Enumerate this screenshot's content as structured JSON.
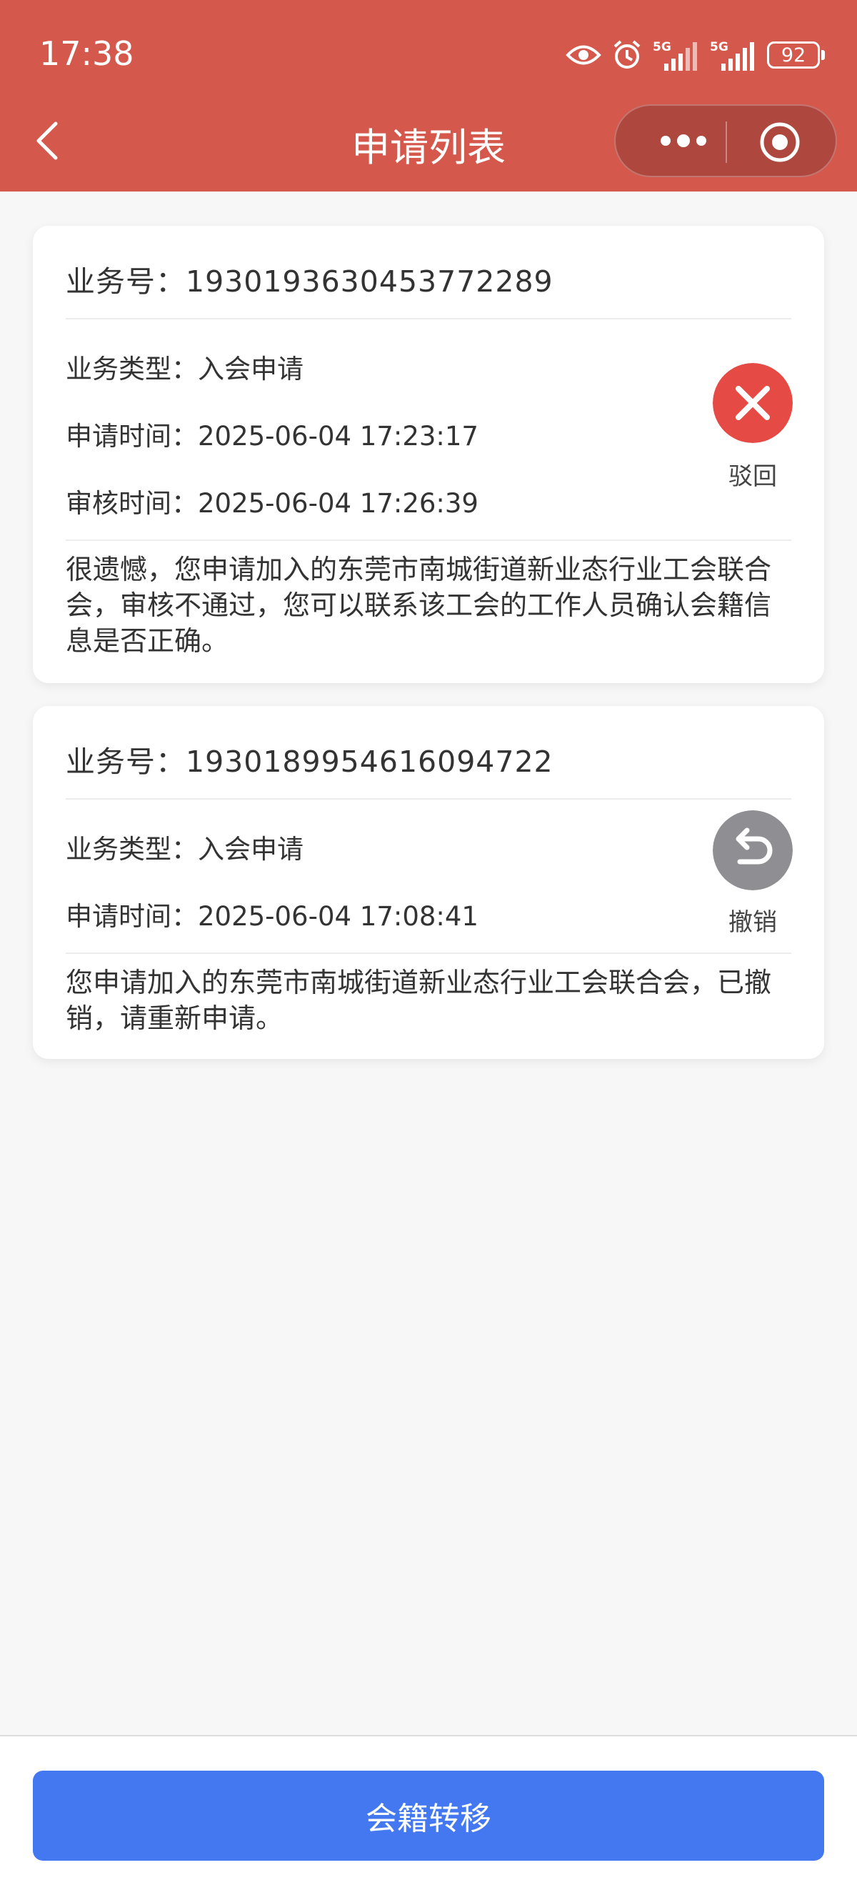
{
  "status_bar": {
    "time": "17:38",
    "battery": "92",
    "icons": [
      "eye-icon",
      "alarm-icon",
      "5g-signal-icon",
      "5g-signal-icon"
    ]
  },
  "nav": {
    "title": "申请列表",
    "back_icon": "chevron-left-icon",
    "more_icon": "more-dots-icon",
    "close_icon": "target-circle-icon"
  },
  "applications": [
    {
      "biz_no": "业务号：1930193630453772289",
      "type": "业务类型：入会申请",
      "apply_time": "申请时间：2025-06-04 17:23:17",
      "review_time": "审核时间：2025-06-04 17:26:39",
      "status": "驳回",
      "status_color": "#e64a45",
      "message": "很遗憾，您申请加入的东莞市南城街道新业态行业工会联合会，审核不通过，您可以联系该工会的工作人员确认会籍信息是否正确。"
    },
    {
      "biz_no": "业务号：1930189954616094722",
      "type": "业务类型：入会申请",
      "apply_time": "申请时间：2025-06-04 17:08:41",
      "status": "撤销",
      "status_color": "#8f8f93",
      "message": "您申请加入的东莞市南城街道新业态行业工会联合会，已撤销，请重新申请。"
    }
  ],
  "footer": {
    "button_label": "会籍转移",
    "button_color": "#4478f1"
  },
  "colors": {
    "header": "#d5584d"
  }
}
